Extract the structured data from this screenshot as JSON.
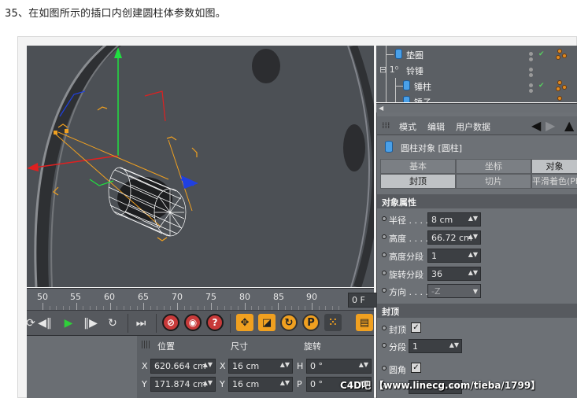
{
  "caption": "35、在如图所示的插口内创建圆柱体参数如图。",
  "timeline": {
    "ticks": [
      "50",
      "55",
      "60",
      "65",
      "70",
      "75",
      "80",
      "85",
      "90"
    ],
    "current_frame": "0 F"
  },
  "coordinate_manager": {
    "headers": {
      "position": "位置",
      "size": "尺寸",
      "rotation": "旋转"
    },
    "rows": [
      {
        "pos_axis": "X",
        "pos_value": "620.664 cm",
        "size_axis": "X",
        "size_value": "16 cm",
        "rot_axis": "H",
        "rot_value": "0 °"
      },
      {
        "pos_axis": "Y",
        "pos_value": "171.874 cm",
        "size_axis": "Y",
        "size_value": "16 cm",
        "rot_axis": "P",
        "rot_value": "0 °"
      }
    ]
  },
  "object_manager": {
    "items": [
      {
        "name": "垫圈"
      },
      {
        "name": "铃锤"
      },
      {
        "name": "锤柱"
      },
      {
        "name": "锤子"
      }
    ]
  },
  "attribute_manager": {
    "menu": [
      "模式",
      "编辑",
      "用户数据"
    ],
    "title": "圆柱对象 [圆柱]",
    "tabs_row1": [
      "基本",
      "坐标",
      "对象"
    ],
    "tabs_row2": [
      "封顶",
      "切片",
      "平滑着色(Ph"
    ],
    "section_object": "对象属性",
    "props": [
      {
        "label": "半径 . . . .",
        "value": "8 cm"
      },
      {
        "label": "高度 . . . .",
        "value": "66.72 cm"
      },
      {
        "label": "高度分段",
        "value": "1"
      },
      {
        "label": "旋转分段",
        "value": "36"
      },
      {
        "label": "方向 . . . .",
        "value": "-Z"
      }
    ],
    "section_caps": "封顶",
    "caps": {
      "cap_label": "封顶",
      "cap_checked": "✓",
      "segments_label": "分段",
      "segments_value": "1",
      "fillet_label": "圆角",
      "fillet_checked": "✓"
    }
  },
  "watermark": "C4D吧 【www.linecg.com/tieba/1799】",
  "colors": {
    "viewport_bg": "#4c5055",
    "panel_bg": "#6d7176",
    "accent_orange": "#f0a020",
    "axis_x": "#e02020",
    "axis_y": "#20e040",
    "axis_z": "#2040e0"
  }
}
